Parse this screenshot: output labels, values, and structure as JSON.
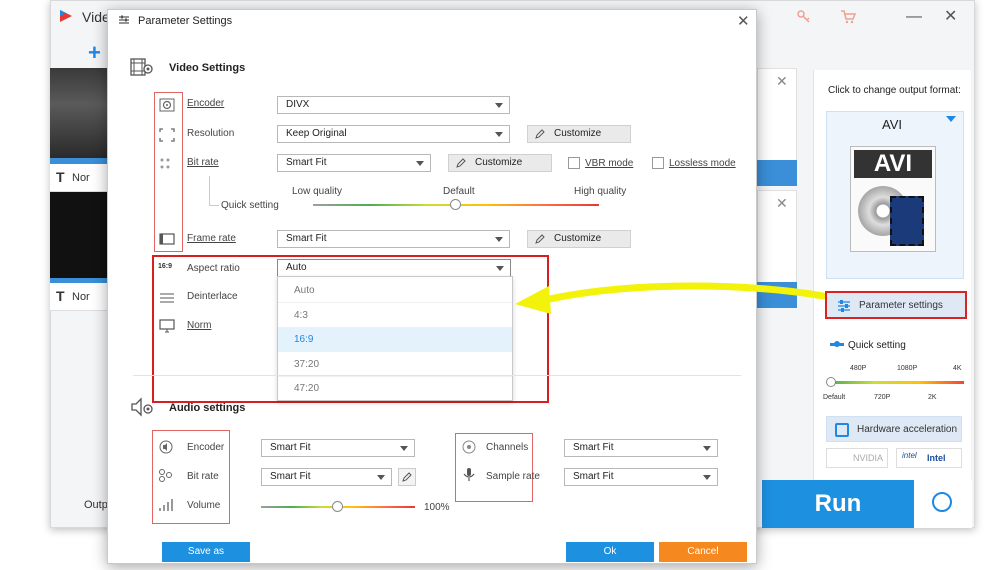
{
  "main_window": {
    "title": "Vide",
    "file_rows": [
      {
        "caption": "Nor"
      },
      {
        "caption": "Nor"
      }
    ],
    "output_label": "Outpu"
  },
  "right_panel": {
    "click_hint": "Click to change output format:",
    "format_name": "AVI",
    "format_badge": "AVI",
    "parameter_settings_label": "Parameter settings",
    "quick_setting_label": "Quick setting",
    "res_top": [
      "480P",
      "1080P",
      "4K"
    ],
    "res_bottom": [
      "Default",
      "720P",
      "2K"
    ],
    "hardware_accel_label": "Hardware acceleration",
    "nvidia_label": "NVIDIA",
    "intel_label": "Intel",
    "run_label": "Run"
  },
  "dialog": {
    "title": "Parameter Settings",
    "video_section_title": "Video Settings",
    "audio_section_title": "Audio settings",
    "video": {
      "encoder_label": "Encoder",
      "encoder_value": "DIVX",
      "resolution_label": "Resolution",
      "resolution_value": "Keep Original",
      "resolution_customize": "Customize",
      "bitrate_label": "Bit rate",
      "bitrate_value": "Smart Fit",
      "bitrate_customize": "Customize",
      "vbr_label": "VBR mode",
      "lossless_label": "Lossless mode",
      "quick_setting_label": "Quick setting",
      "low_quality": "Low quality",
      "default_quality": "Default",
      "high_quality": "High quality",
      "quality_level": 0.5,
      "framerate_label": "Frame rate",
      "framerate_value": "Smart Fit",
      "framerate_customize": "Customize",
      "aspect_label": "Aspect ratio",
      "aspect_value": "Auto",
      "aspect_options": [
        "Auto",
        "4:3",
        "16:9",
        "37:20",
        "47:20"
      ],
      "aspect_highlighted": "16:9",
      "deinterlace_label": "Deinterlace",
      "norm_label": "Norm"
    },
    "audio": {
      "encoder_label": "Encoder",
      "encoder_value": "Smart Fit",
      "bitrate_label": "Bit rate",
      "bitrate_value": "Smart Fit",
      "volume_label": "Volume",
      "volume_value": "100%",
      "volume_level": 0.5,
      "channels_label": "Channels",
      "channels_value": "Smart Fit",
      "samplerate_label": "Sample rate",
      "samplerate_value": "Smart Fit"
    },
    "buttons": {
      "save_as": "Save as",
      "ok": "Ok",
      "cancel": "Cancel"
    }
  },
  "colors": {
    "accent": "#1e88e5",
    "annotation_red": "#d81e1e",
    "cancel_orange": "#f5891f",
    "arrow_yellow": "#f2f20a"
  }
}
